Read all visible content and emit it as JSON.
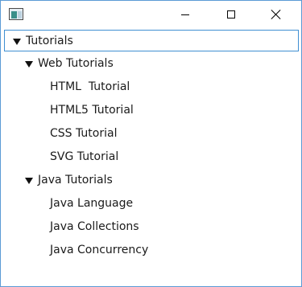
{
  "window": {
    "title": ""
  },
  "tree": {
    "items": [
      {
        "label": "Tutorials",
        "level": 0,
        "expanded": true,
        "selected": true
      },
      {
        "label": "Web Tutorials",
        "level": 1,
        "expanded": true
      },
      {
        "label": "HTML  Tutorial",
        "level": 2
      },
      {
        "label": "HTML5 Tutorial",
        "level": 2
      },
      {
        "label": "CSS Tutorial",
        "level": 2
      },
      {
        "label": "SVG Tutorial",
        "level": 2
      },
      {
        "label": "Java Tutorials",
        "level": 1,
        "expanded": true
      },
      {
        "label": "Java Language",
        "level": 2
      },
      {
        "label": "Java Collections",
        "level": 2
      },
      {
        "label": "Java Concurrency",
        "level": 2
      }
    ]
  },
  "icons": {
    "app": "app-window-icon",
    "minimize": "minimize-icon",
    "maximize": "maximize-icon",
    "close": "close-icon",
    "expand": "triangle-down-icon"
  }
}
